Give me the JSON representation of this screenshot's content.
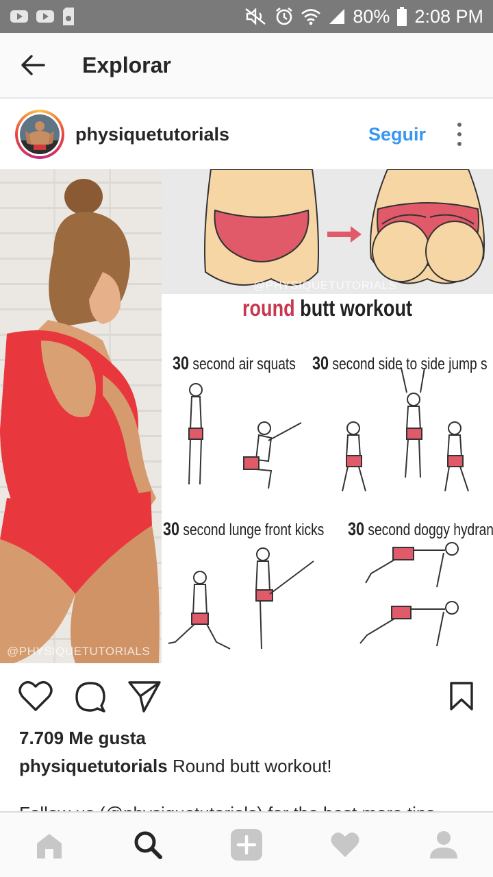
{
  "status_bar": {
    "battery": "80%",
    "time": "2:08 PM",
    "icons": [
      "video-icon",
      "video-icon",
      "storage-icon",
      "mute-icon",
      "alarm-icon",
      "wifi-icon",
      "signal-icon",
      "battery-icon"
    ]
  },
  "header": {
    "title": "Explorar",
    "back_icon": "back-arrow-icon"
  },
  "post": {
    "username": "physiquetutorials",
    "follow_label": "Seguir",
    "more_icon": "more-vertical-icon",
    "image": {
      "watermark_bottom": "@PHYSIQUETUTORIALS",
      "watermark_top": "@PHYSIQUETUTORIALS",
      "title_accent": "round",
      "title_rest": "butt workout",
      "exercises": [
        {
          "num": "30",
          "text": "second air squats"
        },
        {
          "num": "30",
          "text": "second side to side jump s"
        },
        {
          "num": "30",
          "text": "second lunge front kicks"
        },
        {
          "num": "30",
          "text": "second doggy hydrants"
        }
      ]
    },
    "likes": "7.709 Me gusta",
    "caption_user": "physiquetutorials",
    "caption_text": "Round butt workout!",
    "caption_more": "Follow us (@physiquetutorials) for the best more tips"
  },
  "colors": {
    "accent": "#3897f0",
    "swimsuit": "#e8383d",
    "title_accent": "#c8374d",
    "nav_icon": "#c7c7c7",
    "nav_active": "#262626"
  },
  "bottom_nav": [
    {
      "name": "home",
      "icon": "home-icon",
      "active": false
    },
    {
      "name": "search",
      "icon": "search-icon",
      "active": true
    },
    {
      "name": "add",
      "icon": "add-post-icon",
      "active": false
    },
    {
      "name": "activity",
      "icon": "heart-icon",
      "active": false
    },
    {
      "name": "profile",
      "icon": "profile-icon",
      "active": false
    }
  ]
}
